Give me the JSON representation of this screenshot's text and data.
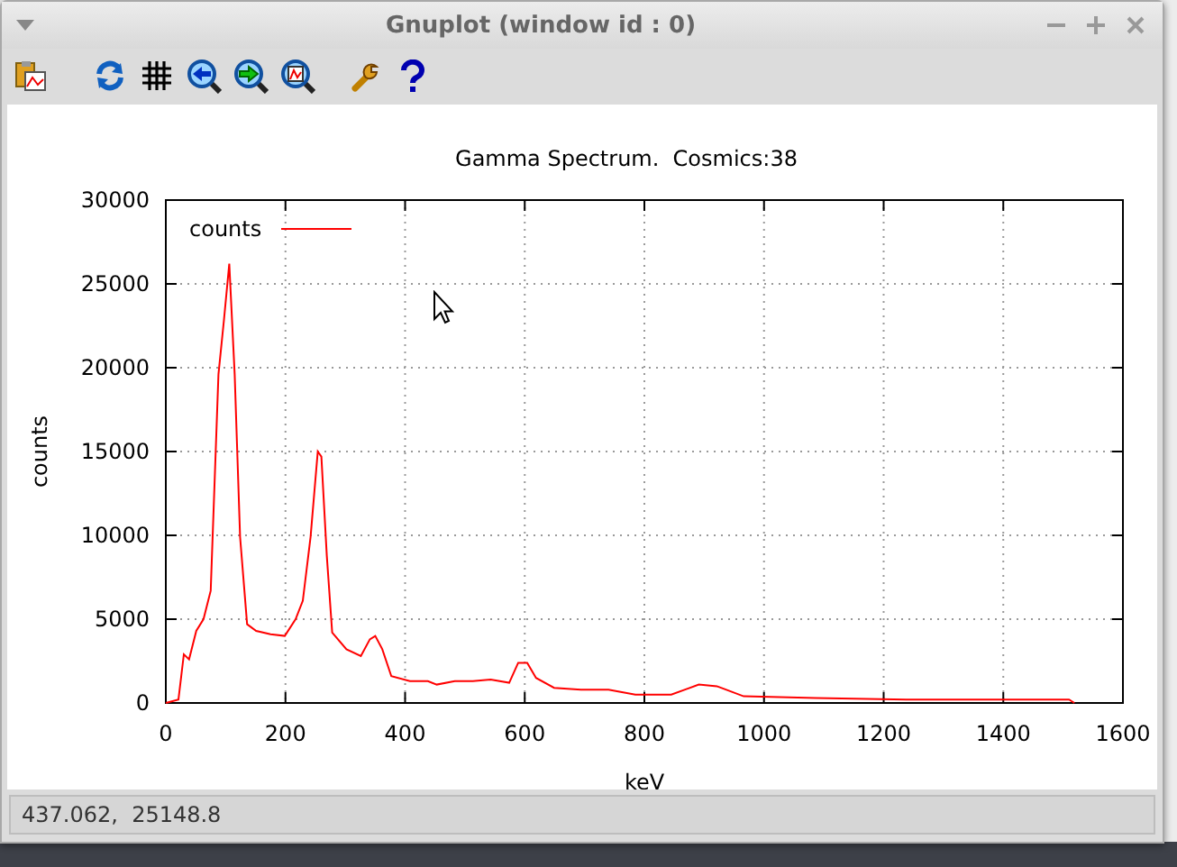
{
  "window": {
    "title": "Gnuplot (window id : 0)"
  },
  "toolbar": {
    "buttons": [
      {
        "kind": "copy"
      },
      {
        "kind": "replot"
      },
      {
        "kind": "grid"
      },
      {
        "kind": "zoom-prev"
      },
      {
        "kind": "zoom-next"
      },
      {
        "kind": "autoscale"
      },
      {
        "kind": "settings"
      },
      {
        "kind": "help"
      }
    ]
  },
  "plot": {
    "chart_data": {
      "type": "line",
      "grid": true,
      "title": "Gamma Spectrum.  Cosmics:38",
      "xlabel": "keV",
      "ylabel": "counts",
      "xlim": [
        0,
        1600
      ],
      "ylim": [
        0,
        30000
      ],
      "xticks": [
        0,
        200,
        400,
        600,
        800,
        1000,
        1200,
        1400,
        1600
      ],
      "yticks": [
        0,
        5000,
        10000,
        15000,
        20000,
        25000,
        30000
      ],
      "x": [
        0,
        21,
        30,
        39,
        51,
        63,
        75,
        88,
        97,
        106,
        115,
        124,
        136,
        151,
        175,
        199,
        217,
        229,
        242,
        254,
        260,
        269,
        278,
        302,
        326,
        341,
        350,
        362,
        377,
        408,
        438,
        453,
        483,
        513,
        543,
        574,
        589,
        604,
        619,
        649,
        694,
        740,
        785,
        845,
        891,
        921,
        966,
        1087,
        1238,
        1419,
        1510,
        1519
      ],
      "series": [
        {
          "name": "counts",
          "color": "#ff0000",
          "values": [
            0,
            200,
            2900,
            2600,
            4300,
            5000,
            6700,
            19600,
            22800,
            26200,
            19600,
            9900,
            4700,
            4300,
            4100,
            4000,
            5000,
            6100,
            9900,
            15000,
            14700,
            8800,
            4200,
            3200,
            2800,
            3800,
            4000,
            3200,
            1600,
            1300,
            1300,
            1100,
            1300,
            1300,
            1400,
            1200,
            2400,
            2400,
            1500,
            900,
            800,
            800,
            500,
            500,
            1100,
            1000,
            400,
            300,
            200,
            200,
            200,
            0
          ]
        }
      ]
    }
  },
  "status_bar": {
    "text": "437.062,  25148.8"
  }
}
